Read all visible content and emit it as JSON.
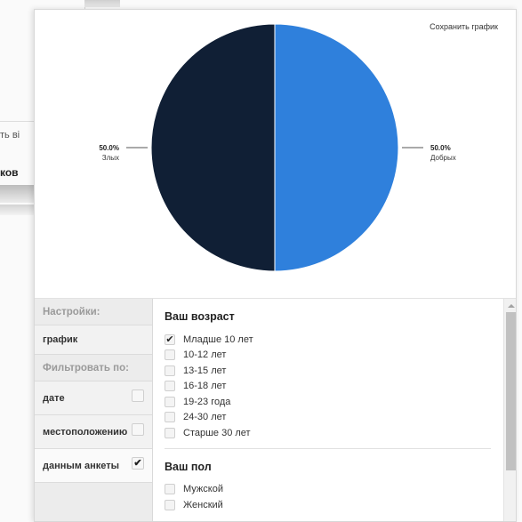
{
  "background": {
    "text_1": "ть ві",
    "text_2": "ков"
  },
  "modal": {
    "save_label": "Сохранить график"
  },
  "chart_data": {
    "type": "pie",
    "start_angle": "top",
    "slices": [
      {
        "label": "Добрых",
        "value": 50.0,
        "display": "50.0%",
        "color": "#2f80dc"
      },
      {
        "label": "Злых",
        "value": 50.0,
        "display": "50.0%",
        "color": "#101f35"
      }
    ]
  },
  "sidebar": {
    "settings_header": "Настройки:",
    "chart_item": "график",
    "filter_header": "Фильтровать по:",
    "filters": [
      {
        "label": "дате",
        "checked": false,
        "check": ""
      },
      {
        "label": "местоположению",
        "checked": false,
        "check": ""
      },
      {
        "label": "данным анкеты",
        "checked": true,
        "check": "✔"
      }
    ]
  },
  "options": {
    "age": {
      "title": "Ваш возраст",
      "items": [
        {
          "label": "Младше 10 лет",
          "checked": true,
          "check": "✔"
        },
        {
          "label": "10-12 лет",
          "checked": false,
          "check": ""
        },
        {
          "label": "13-15 лет",
          "checked": false,
          "check": ""
        },
        {
          "label": "16-18 лет",
          "checked": false,
          "check": ""
        },
        {
          "label": "19-23 года",
          "checked": false,
          "check": ""
        },
        {
          "label": "24-30 лет",
          "checked": false,
          "check": ""
        },
        {
          "label": "Старше 30 лет",
          "checked": false,
          "check": ""
        }
      ]
    },
    "gender": {
      "title": "Ваш пол",
      "items": [
        {
          "label": "Мужской",
          "checked": false,
          "check": ""
        },
        {
          "label": "Женский",
          "checked": false,
          "check": ""
        }
      ]
    }
  }
}
